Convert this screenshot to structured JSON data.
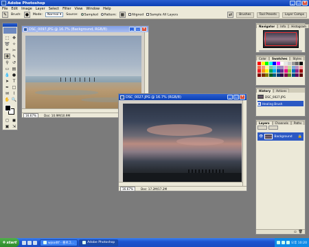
{
  "app": {
    "title": "Adobe Photoshop"
  },
  "menu": [
    "File",
    "Edit",
    "Image",
    "Layer",
    "Select",
    "Filter",
    "View",
    "Window",
    "Help"
  ],
  "options": {
    "brush_label": "Brush:",
    "mode_label": "Mode:",
    "mode_value": "Normal",
    "source_label": "Source:",
    "sampled_label": "Sampled",
    "pattern_label": "Pattern:",
    "aligned_label": "Aligned",
    "sample_all_label": "Sample All Layers",
    "well_tabs": [
      "Brushes",
      "Tool Presets",
      "Layer Comps"
    ]
  },
  "doc1": {
    "title": "DSC_0097.JPG @ 16.7% (Background, RGB/8)",
    "zoom": "16.67%",
    "doc_info": "Doc: 10.9M/10.9M"
  },
  "doc2": {
    "title": "DSC_0027.JPG @ 16.7% (RGB/8)",
    "zoom": "16.67%",
    "doc_info": "Doc: 17.2M/17.2M"
  },
  "navigator": {
    "tabs": [
      "Navigator",
      "Info",
      "Histogram"
    ]
  },
  "color": {
    "tabs": [
      "Color",
      "Swatches",
      "Styles"
    ]
  },
  "history": {
    "tabs": [
      "History",
      "Actions"
    ],
    "items": [
      {
        "label": "DSC_0027.JPG"
      },
      {
        "label": "Healing Brush"
      }
    ]
  },
  "layers": {
    "tabs": [
      "Layers",
      "Channels",
      "Paths"
    ],
    "layer_name": "Background"
  },
  "taskbar": {
    "start": "start",
    "tasks": [
      {
        "label": "wjsodtf - 롤로그..."
      },
      {
        "label": "Adobe Photoshop"
      }
    ],
    "clock": "오후 10:20"
  },
  "swatch_colors": [
    "#ff0000",
    "#ffff00",
    "#00ff00",
    "#00ffff",
    "#0000ff",
    "#ff00ff",
    "#ffffff",
    "#e6e6e6",
    "#cccccc",
    "#999999",
    "#666666",
    "#000000",
    "#f26c4f",
    "#f69679",
    "#fff79a",
    "#82ca9d",
    "#6dcff6",
    "#8393ca",
    "#a186be",
    "#f49ac1",
    "#c4df9b",
    "#7da7d9",
    "#bd8cbf",
    "#f5989d",
    "#ed1c24",
    "#f7941d",
    "#fff200",
    "#00a651",
    "#00aeef",
    "#0054a6",
    "#662d91",
    "#ec008c",
    "#8dc63f",
    "#0072bc",
    "#92278f",
    "#9e0b0f",
    "#790000",
    "#7b2e00",
    "#827b00",
    "#005e20",
    "#005b7f",
    "#003471",
    "#32004b",
    "#7b0046",
    "#598527",
    "#004a80",
    "#630460",
    "#5c0000"
  ]
}
